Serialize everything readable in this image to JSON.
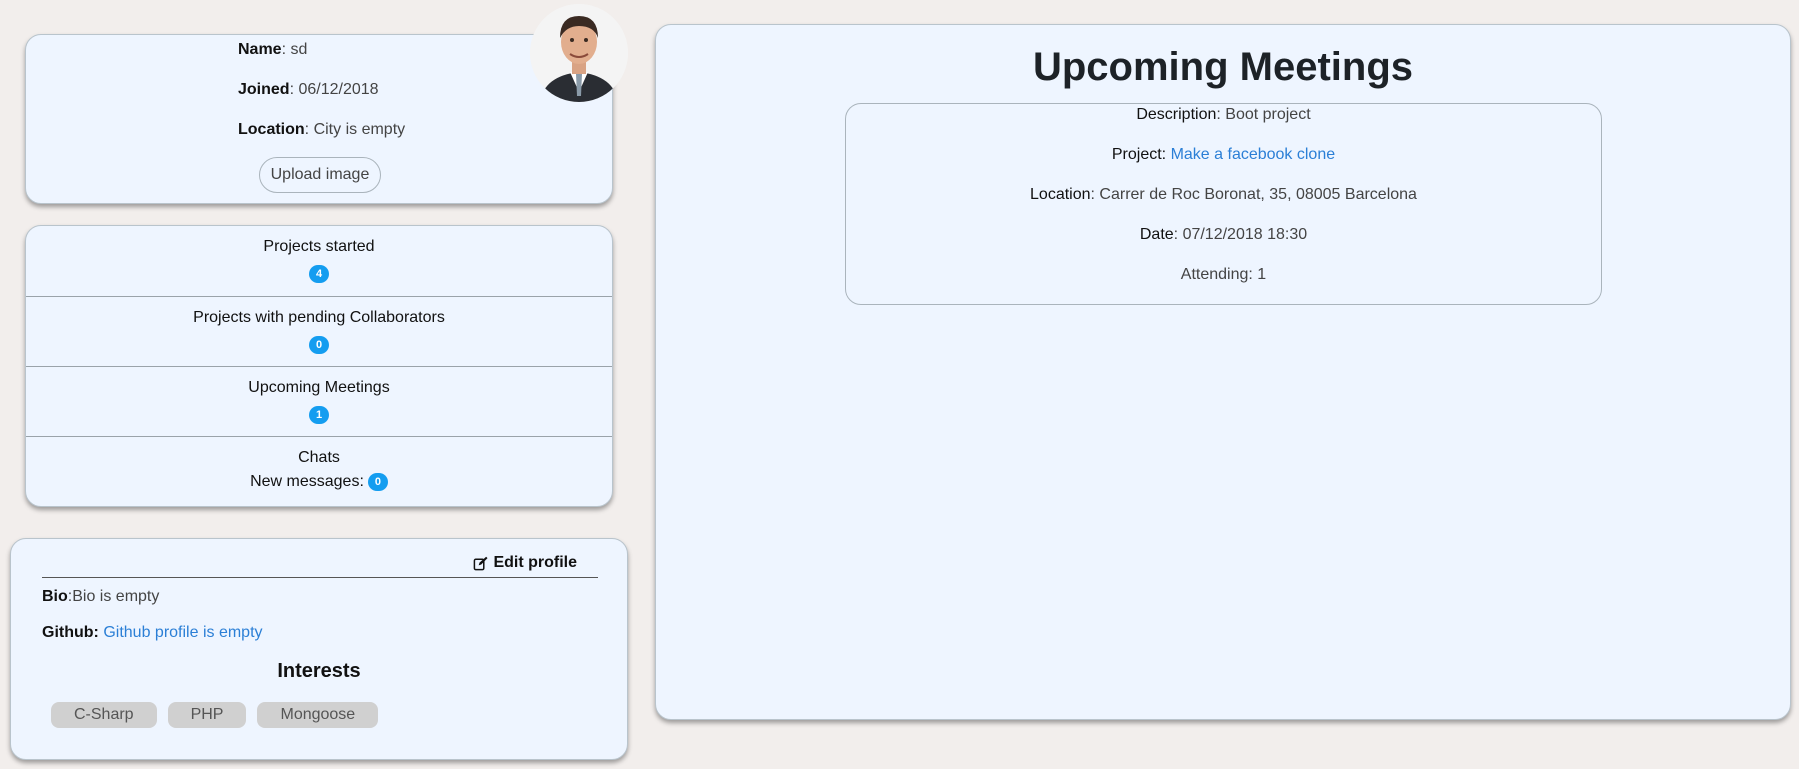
{
  "profile": {
    "name_label": "Name",
    "name_value": ": sd",
    "joined_label": "Joined",
    "joined_value": ": 06/12/2018",
    "location_label": "Location",
    "location_value": ": City is empty",
    "upload_label": "Upload image"
  },
  "stats": [
    {
      "label": "Projects started",
      "count": "4"
    },
    {
      "label": "Projects with pending Collaborators",
      "count": "0"
    },
    {
      "label": "Upcoming Meetings",
      "count": "1"
    },
    {
      "label": "Chats",
      "sub_label": "New messages:",
      "count": "0"
    }
  ],
  "bio": {
    "edit_label": "Edit profile",
    "bio_label": "Bio",
    "bio_value": ":Bio is empty",
    "github_label": "Github:",
    "github_value": "Github profile is empty",
    "interests_title": "Interests",
    "interests": [
      "C-Sharp",
      "PHP",
      "Mongoose"
    ]
  },
  "meetings": {
    "title": "Upcoming Meetings",
    "items": [
      {
        "description_label": "Description",
        "description_value": ": Boot project",
        "project_label": "Project:",
        "project_value": "Make a facebook clone",
        "location_label": "Location",
        "location_value": ": Carrer de Roc Boronat, 35, 08005 Barcelona",
        "date_label": "Date",
        "date_value": ": 07/12/2018 18:30",
        "attending": "Attending: 1"
      }
    ]
  },
  "colors": {
    "card_bg": "#eef5ff",
    "page_bg": "#f2eeec",
    "badge": "#149df0",
    "link": "#2b7fd6"
  }
}
